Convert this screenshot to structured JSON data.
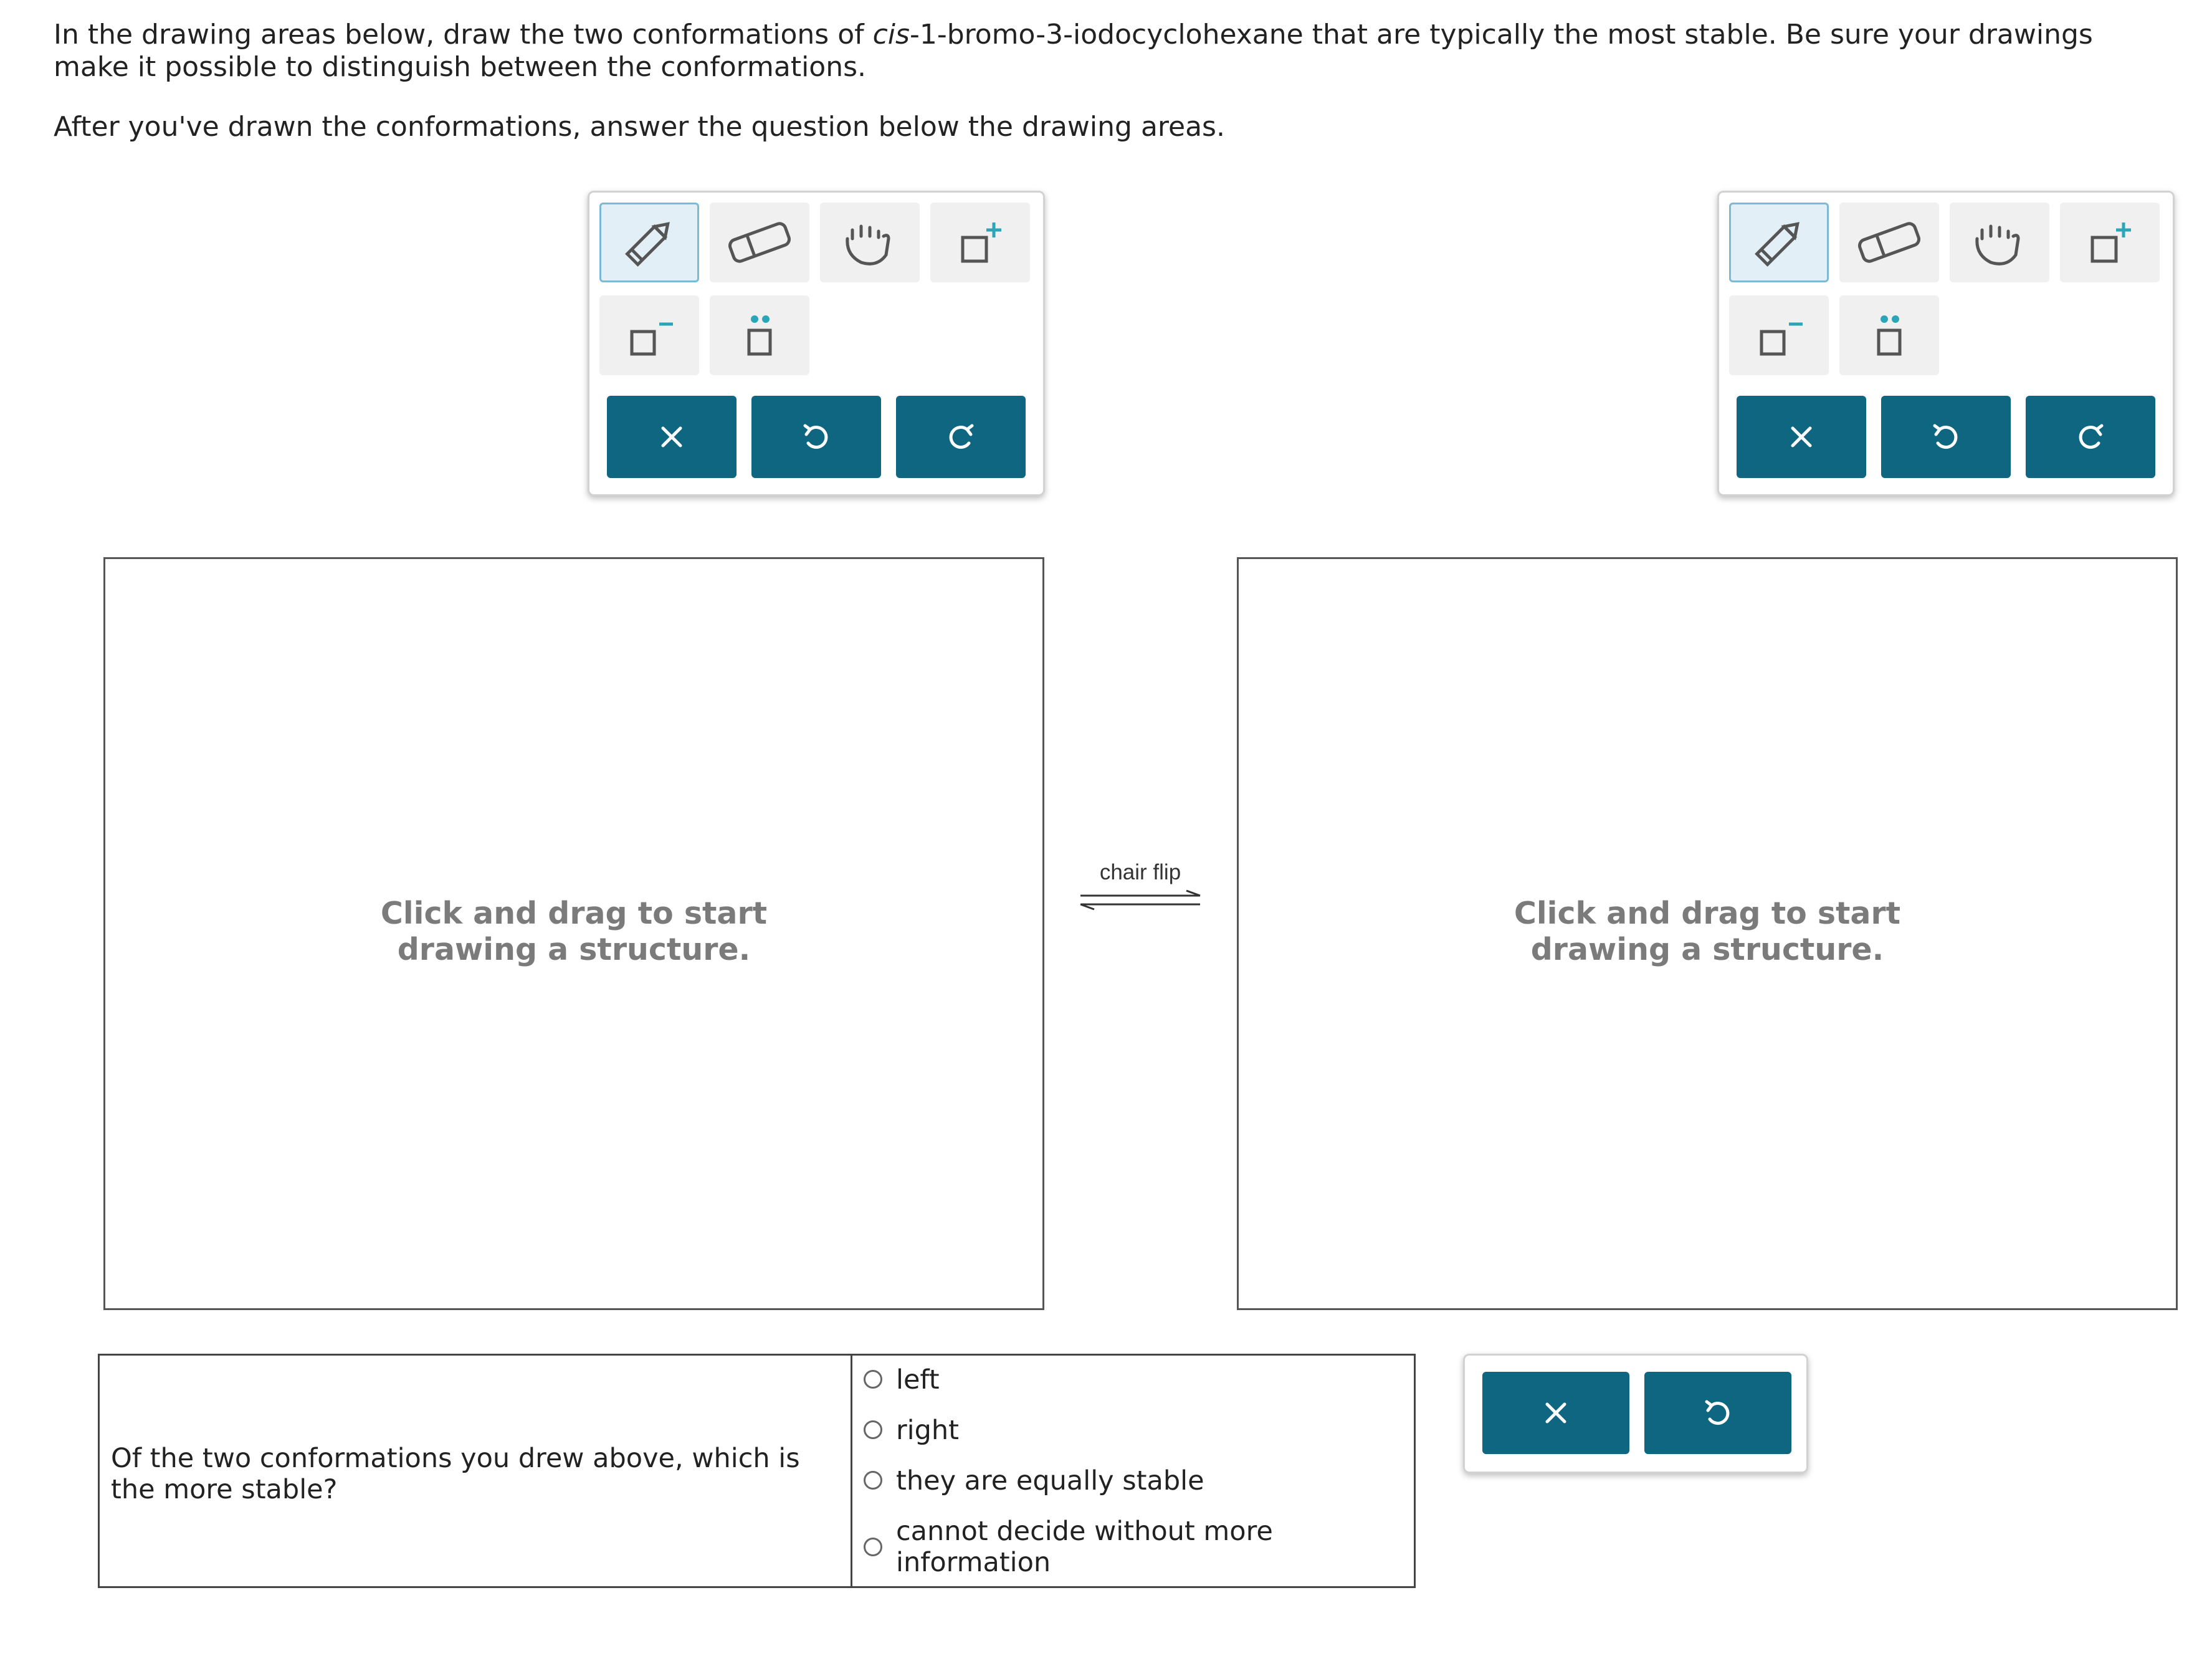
{
  "instructions": {
    "line1_pre": "In the drawing areas below, draw the two conformations of ",
    "compound_prefix": "cis",
    "line1_post": "-1-bromo-3-iodocyclohexane that are typically the most stable. Be sure your drawings make it possible to distinguish between the conformations.",
    "line2": "After you've drawn the conformations, answer the question below the drawing areas."
  },
  "toolbar": {
    "tools": [
      "pencil-icon",
      "eraser-icon",
      "hand-icon",
      "add-charge-icon",
      "remove-charge-icon",
      "lone-pair-icon"
    ],
    "buttons": [
      {
        "name": "clear-button",
        "icon": "x-icon"
      },
      {
        "name": "undo-button",
        "icon": "undo-icon"
      },
      {
        "name": "redo-button",
        "icon": "redo-icon"
      }
    ]
  },
  "canvas": {
    "hint_line1": "Click and drag to start",
    "hint_line2": "drawing a structure."
  },
  "equilibrium": {
    "label": "chair flip"
  },
  "question": {
    "prompt": "Of the two conformations you drew above, which is the more stable?",
    "options": [
      "left",
      "right",
      "they are equally stable",
      "cannot decide without more information"
    ],
    "selected": null
  },
  "answer_buttons": [
    {
      "name": "clear-answer-button",
      "icon": "x-icon"
    },
    {
      "name": "undo-answer-button",
      "icon": "undo-icon"
    }
  ],
  "colors": {
    "button_teal": "#0e6680",
    "active_tool_bg": "#e3eff6",
    "hint_gray": "#7b7b7b"
  }
}
